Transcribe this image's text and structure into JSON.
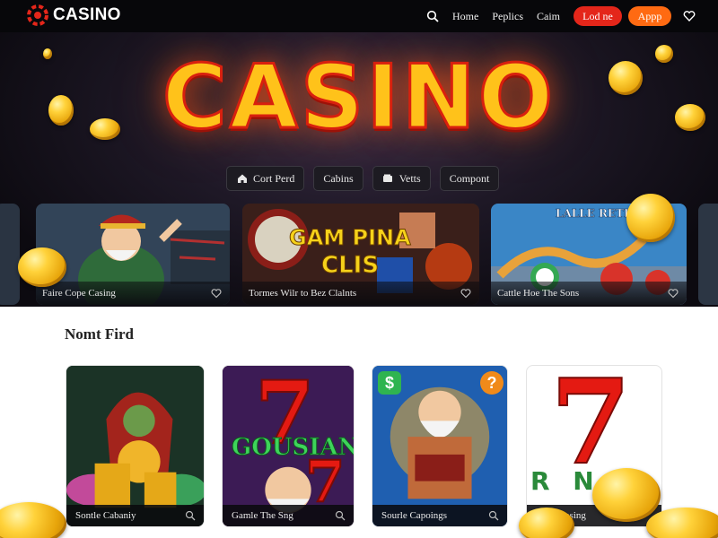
{
  "brand": {
    "name": "CASINO"
  },
  "nav": {
    "links": [
      "Home",
      "Peplics",
      "Caim"
    ],
    "login_label": "Lod ne",
    "app_label": "Appp"
  },
  "hero": {
    "title": "CASINO",
    "pills": [
      {
        "label": "Cort Perd",
        "icon": "house-icon"
      },
      {
        "label": "Cabins",
        "icon": ""
      },
      {
        "label": "Vetts",
        "icon": "wallet-icon"
      },
      {
        "label": "Compont",
        "icon": ""
      }
    ],
    "cards": [
      {
        "caption": "Faire Cope Casing"
      },
      {
        "caption": "Tormes Wilr to Bez Clalnts",
        "art_text": [
          "GAM PINA",
          "CLIS"
        ]
      },
      {
        "caption": "Cattle Hoe The Sons",
        "art_text": "LALLE RETRO"
      }
    ]
  },
  "section": {
    "title": "Nomt Fird",
    "tiles": [
      {
        "caption": "Sontle Cabaniy"
      },
      {
        "caption": "Gamle The Sng",
        "art_text": "GOUSIAN"
      },
      {
        "caption": "Sourle Capoings",
        "badges": [
          "$",
          "?"
        ]
      },
      {
        "caption": "Esie Closing",
        "art_text": "R N"
      }
    ]
  },
  "colors": {
    "brand_red": "#e4261a",
    "app_orange": "#ff6a12",
    "gold": "#ffc21a",
    "header_bg": "#07070a"
  }
}
